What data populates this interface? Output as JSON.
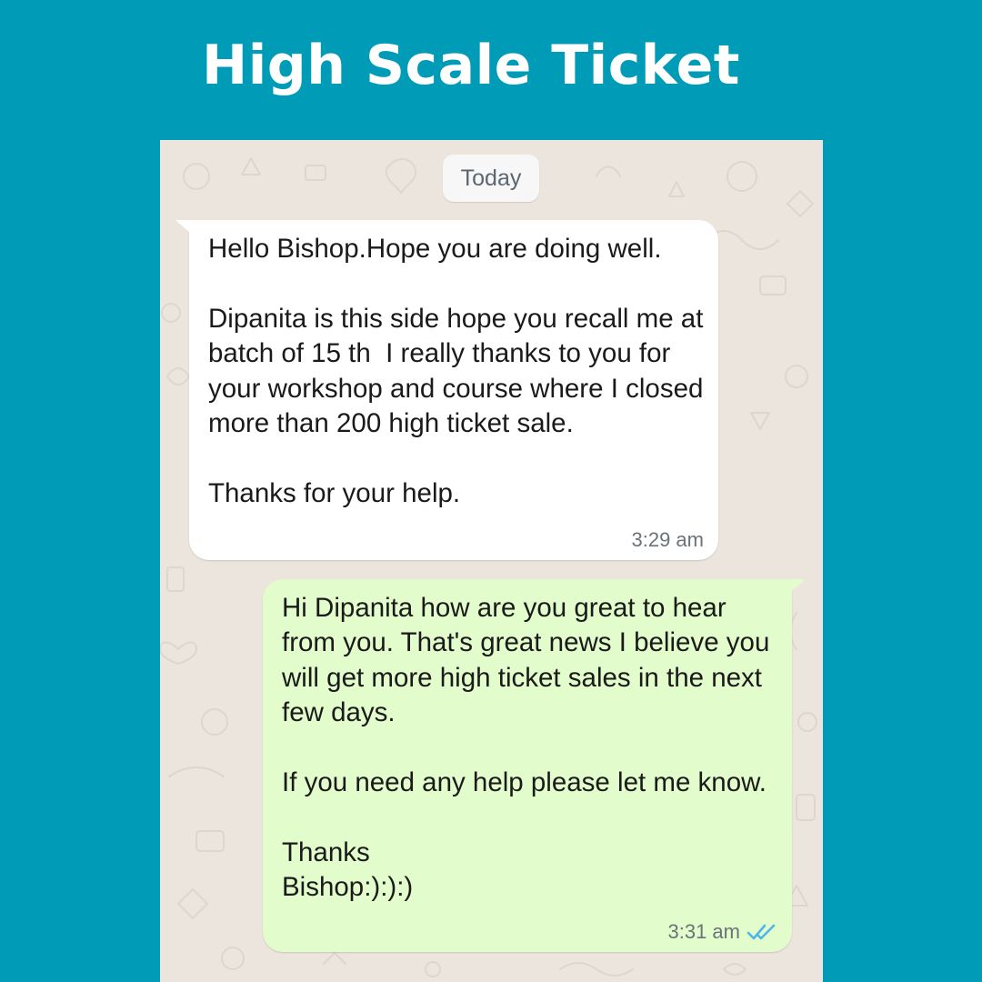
{
  "page": {
    "title": "High Scale Ticket"
  },
  "colors": {
    "background": "#009bb7",
    "chat_wallpaper": "#ece5dd",
    "incoming_bubble": "#ffffff",
    "outgoing_bubble": "#e2fccb",
    "read_ticks": "#4fb6ec"
  },
  "chat": {
    "date_chip": "Today",
    "messages": [
      {
        "direction": "incoming",
        "text": "Hello Bishop.Hope you are doing well.\n\nDipanita is this side hope you recall me at batch of 15 th  I really thanks to you for your workshop and course where I closed more than 200 high ticket sale.\n\nThanks for your help.",
        "time": "3:29 am"
      },
      {
        "direction": "outgoing",
        "text": "Hi Dipanita how are you great to hear from you. That's great news I believe you will get more high ticket sales in the next few days.\n\nIf you need any help please let me know.\n\nThanks\nBishop:):):)",
        "time": "3:31 am",
        "status_icon": "double-check-read-icon"
      }
    ]
  }
}
